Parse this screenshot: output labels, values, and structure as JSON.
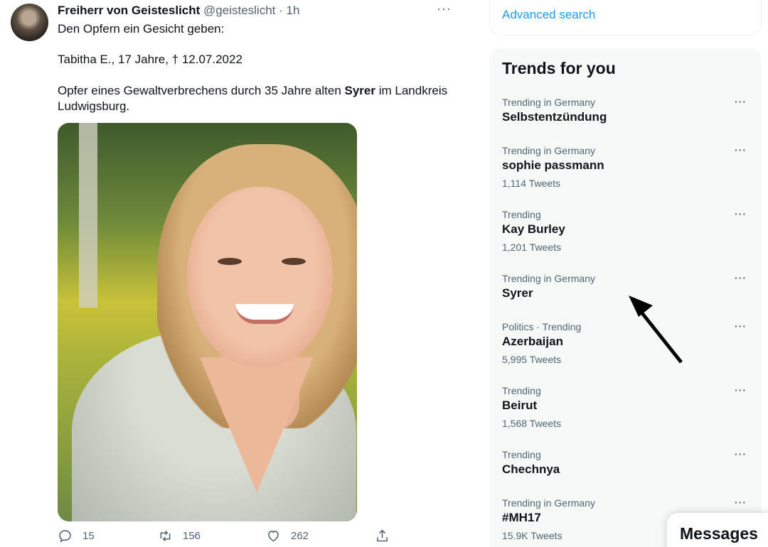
{
  "tweet": {
    "author_name": "Freiherr von Geisteslicht",
    "handle": "@geisteslicht",
    "separator": "·",
    "time": "1h",
    "more": "···",
    "line1": "Den Opfern ein Gesicht geben:",
    "line2": "Tabitha E., 17 Jahre, † 12.07.2022",
    "line3_part1": "Opfer eines Gewaltverbrechens durch 35 Jahre alten ",
    "line3_bold": "Syrer",
    "line3_part2": " im Landkreis Ludwigsburg.",
    "replies": "15",
    "retweets": "156",
    "likes": "262"
  },
  "sidebar": {
    "advanced_search": "Advanced search",
    "trends_title": "Trends for you",
    "trends": [
      {
        "meta": "Trending in Germany",
        "topic": "Selbstentzündung",
        "count": ""
      },
      {
        "meta": "Trending in Germany",
        "topic": "sophie passmann",
        "count": "1,114 Tweets"
      },
      {
        "meta": "Trending",
        "topic": "Kay Burley",
        "count": "1,201 Tweets"
      },
      {
        "meta": "Trending in Germany",
        "topic": "Syrer",
        "count": ""
      },
      {
        "meta": "Politics · Trending",
        "topic": "Azerbaijan",
        "count": "5,995 Tweets"
      },
      {
        "meta": "Trending",
        "topic": "Beirut",
        "count": "1,568 Tweets"
      },
      {
        "meta": "Trending",
        "topic": "Chechnya",
        "count": ""
      },
      {
        "meta": "Trending in Germany",
        "topic": "#MH17",
        "count": "15.9K Tweets"
      }
    ],
    "trend_more": "···"
  },
  "messages": {
    "label": "Messages"
  },
  "colors": {
    "accent": "#1d9bf0",
    "text": "#0f1419",
    "muted": "#536471",
    "panel": "#f7f9f9"
  }
}
